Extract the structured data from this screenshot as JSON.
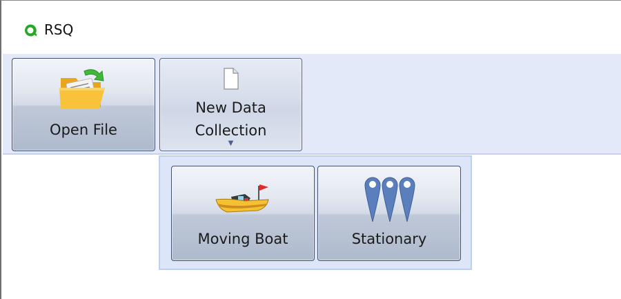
{
  "window": {
    "title": "RSQ",
    "icon": "rsq-logo-icon",
    "accent_color": "#22a81f"
  },
  "ribbon": {
    "buttons": {
      "open_file": {
        "label": "Open File",
        "icon": "folder-open-icon"
      },
      "new_data_collection": {
        "label_line1": "New Data",
        "label_line2": "Collection",
        "icon": "new-document-icon",
        "dropdown_indicator": "▼"
      }
    }
  },
  "dropdown": {
    "items": [
      {
        "label": "Moving Boat",
        "icon": "boat-icon"
      },
      {
        "label": "Stationary",
        "icon": "location-pins-icon"
      }
    ]
  }
}
